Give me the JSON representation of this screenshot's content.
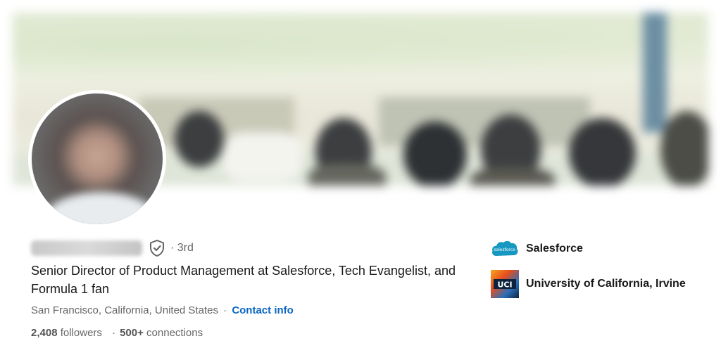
{
  "profile": {
    "degree_label": "· 3rd",
    "headline": "Senior Director of Product Management at Salesforce, Tech Evangelist, and Formula 1 fan",
    "location": "San Francisco, California, United States",
    "location_separator": "·",
    "contact_info_label": "Contact info",
    "followers_count": "2,408",
    "followers_label": "followers",
    "connections_separator": "·",
    "connections_count": "500+",
    "connections_label": "connections"
  },
  "organizations": [
    {
      "name": "Salesforce",
      "logo_text": "salesforce",
      "icon": "salesforce-cloud-logo",
      "color": "#1798c1"
    },
    {
      "name": "University of California, Irvine",
      "logo_text": "UCI",
      "icon": "uci-logo",
      "color": "#0c2340"
    }
  ],
  "icons": {
    "verification": "shield-check-icon"
  },
  "colors": {
    "link": "#0a66c2",
    "secondary_text": "#666666",
    "primary_text": "#191919"
  }
}
